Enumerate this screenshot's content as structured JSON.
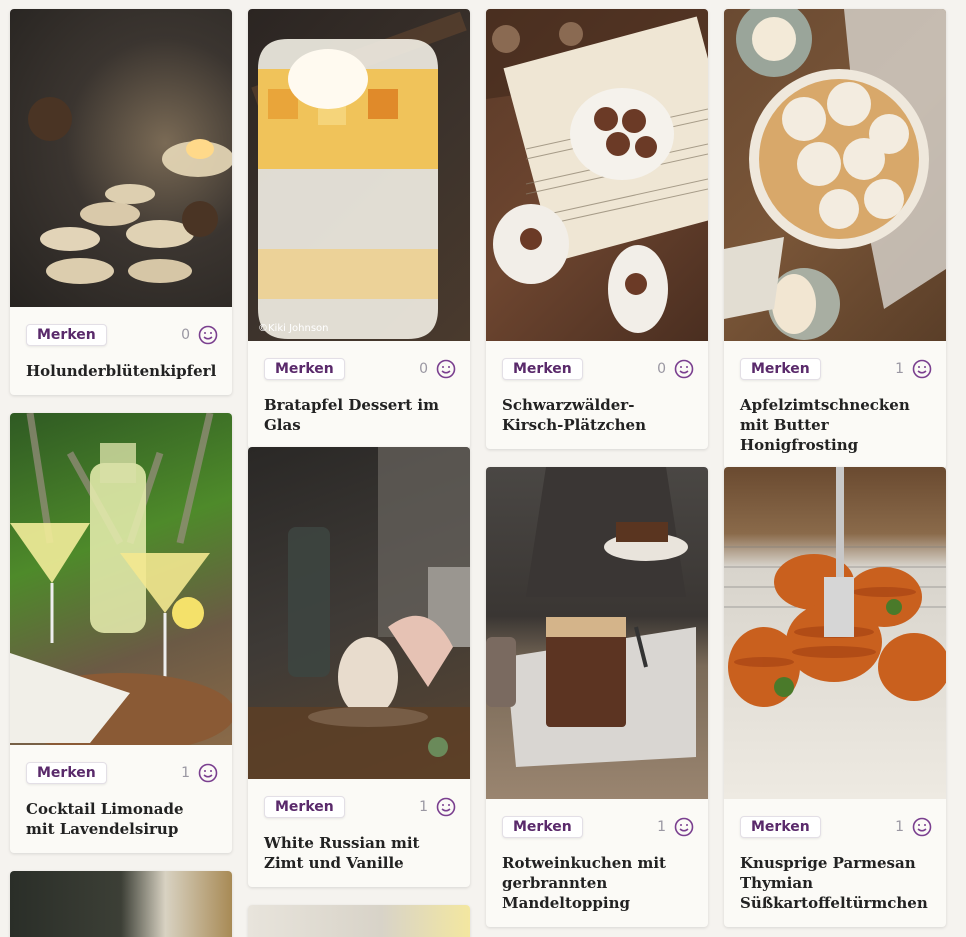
{
  "save_label": "Merken",
  "accent": "#5a2a6b",
  "cards": [
    {
      "title": "Holunderblütenkipferl",
      "likes": "0"
    },
    {
      "title": "Cocktail Limonade mit Lavendelsirup",
      "likes": "1"
    },
    {
      "title": "Bratapfel Dessert im Glas",
      "likes": "0",
      "photo_credit": "©Kiki Johnson"
    },
    {
      "title": "White Russian mit Zimt und Vanille",
      "likes": "1"
    },
    {
      "title": "Schwarzwälder-Kirsch-Plätzchen",
      "likes": "0"
    },
    {
      "title": "Rotweinkuchen mit gerbrannten Mandeltopping",
      "likes": "1"
    },
    {
      "title": "Apfelzimtschnecken mit Butter Honigfrosting",
      "likes": "1"
    },
    {
      "title": "Knusprige Parmesan Thymian Süßkartoffeltürmchen",
      "likes": "1"
    }
  ]
}
